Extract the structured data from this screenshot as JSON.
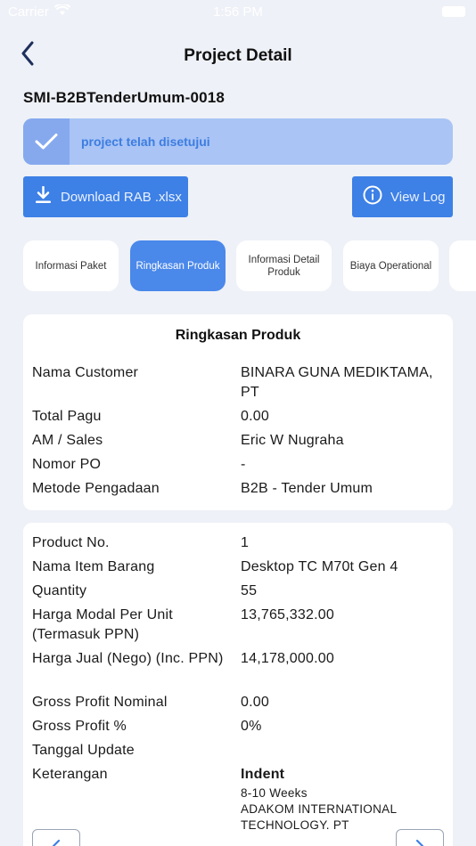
{
  "status_bar": {
    "carrier": "Carrier",
    "time": "1:56 PM"
  },
  "header": {
    "title": "Project Detail",
    "back_icon": "chevron-left-icon"
  },
  "project": {
    "code": "SMI-B2BTenderUmum-0018",
    "approval_message": "project telah disetujui",
    "approval_icon": "checkmark-icon"
  },
  "actions": {
    "download_label": "Download RAB .xlsx",
    "download_icon": "download-icon",
    "viewlog_label": "View Log",
    "viewlog_icon": "info-icon"
  },
  "tabs": [
    {
      "label": "Informasi Paket",
      "active": false
    },
    {
      "label": "Ringkasan Produk",
      "active": true
    },
    {
      "label": "Informasi Detail Produk",
      "active": false
    },
    {
      "label": "Biaya Operational",
      "active": false
    }
  ],
  "summary": {
    "title": "Ringkasan Produk",
    "rows": [
      {
        "label": "Nama Customer",
        "value": "BINARA GUNA MEDIKTAMA, PT"
      },
      {
        "label": "Total Pagu",
        "value": "0.00"
      },
      {
        "label": "AM / Sales",
        "value": "Eric W Nugraha"
      },
      {
        "label": "Nomor PO",
        "value": "-"
      },
      {
        "label": "Metode Pengadaan",
        "value": "B2B - Tender Umum"
      }
    ]
  },
  "product": {
    "rows": [
      {
        "label": "Product No.",
        "value": "1"
      },
      {
        "label": "Nama Item Barang",
        "value": "Desktop TC M70t Gen 4"
      },
      {
        "label": "Quantity",
        "value": "55"
      },
      {
        "label": "Harga Modal Per Unit (Termasuk PPN)",
        "value": "13,765,332.00"
      },
      {
        "label": "Harga Jual (Nego) (Inc. PPN)",
        "value": "14,178,000.00"
      },
      {
        "label": "Gross Profit Nominal",
        "value": "0.00"
      },
      {
        "label": "Gross Profit %",
        "value": "0%"
      },
      {
        "label": "Tanggal Update",
        "value": ""
      },
      {
        "label": "Keterangan",
        "value": "Indent",
        "sub1": "8-10 Weeks",
        "sub2": "ADAKOM INTERNATIONAL TECHNOLOGY. PT"
      }
    ]
  },
  "pager": {
    "prev_icon": "chevron-left-icon",
    "next_icon": "chevron-right-icon"
  },
  "colors": {
    "primary": "#3d80e6",
    "banner": "#a9c4f5",
    "background": "#eef1f7"
  }
}
